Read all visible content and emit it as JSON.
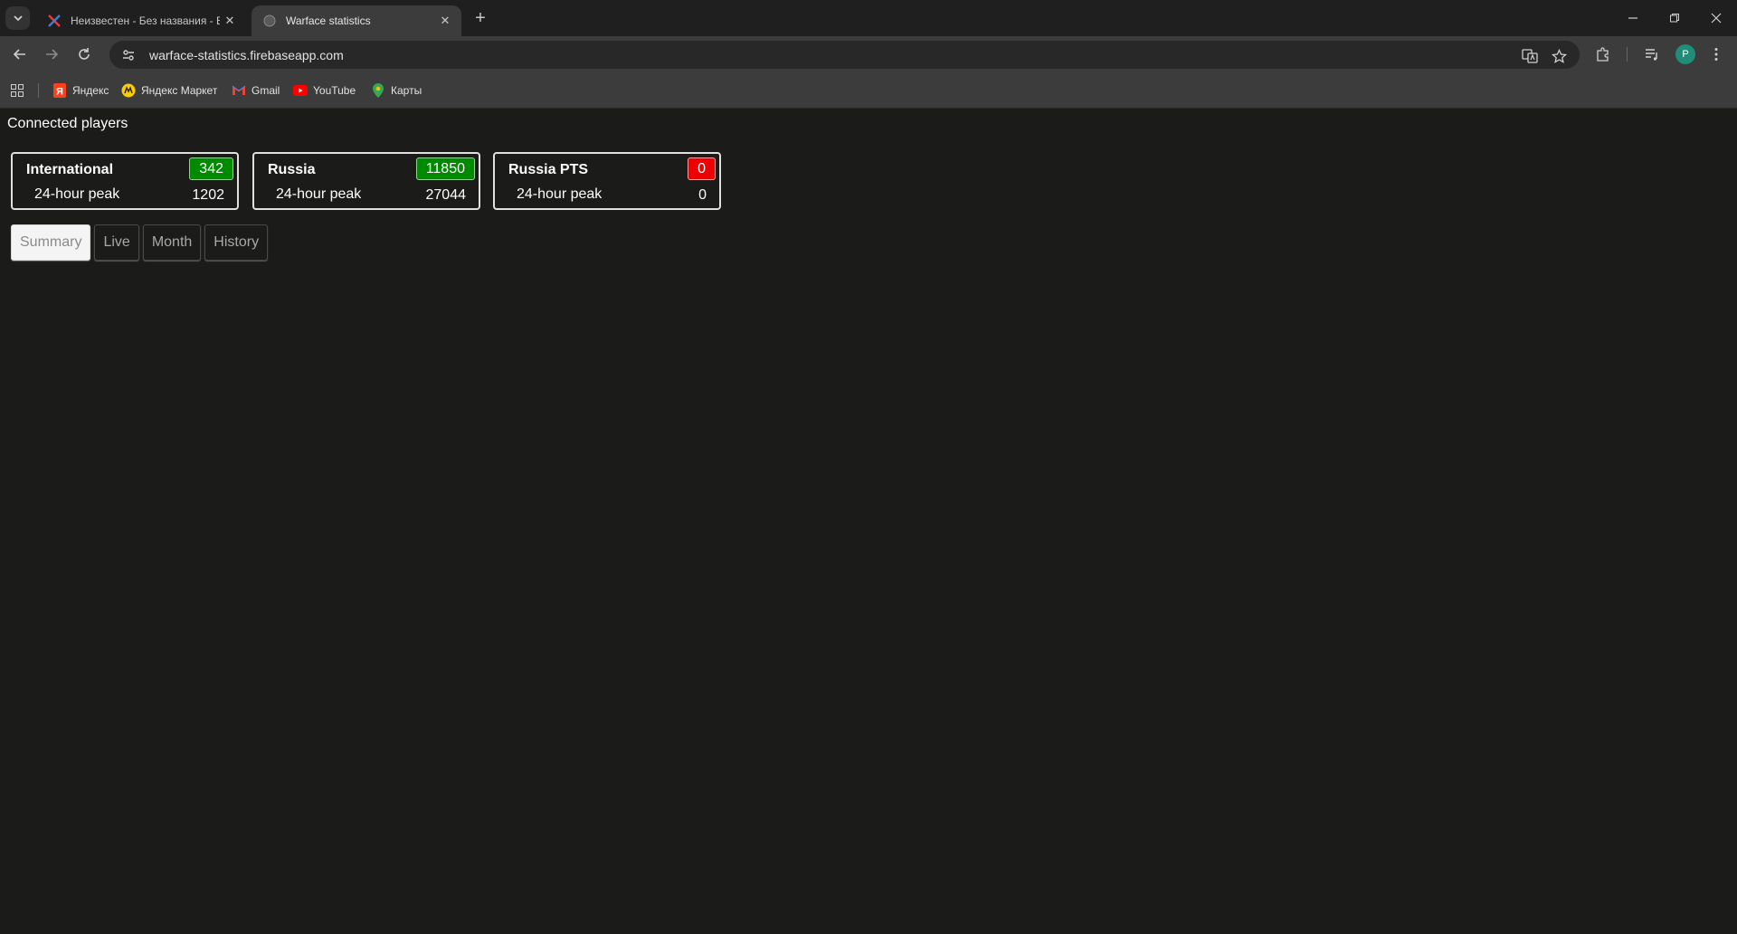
{
  "browser": {
    "tabs": [
      {
        "title": "Неизвестен - Без названия - E",
        "active": false
      },
      {
        "title": "Warface statistics",
        "active": true
      }
    ],
    "url": "warface-statistics.firebaseapp.com",
    "profile_initial": "P",
    "bookmarks": [
      {
        "label": "Яндекс"
      },
      {
        "label": "Яндекс Маркет"
      },
      {
        "label": "Gmail"
      },
      {
        "label": "YouTube"
      },
      {
        "label": "Карты"
      }
    ]
  },
  "page": {
    "title": "Connected players",
    "servers": [
      {
        "name": "International",
        "online": "342",
        "peak_label": "24-hour peak",
        "peak": "1202",
        "status": "green"
      },
      {
        "name": "Russia",
        "online": "11850",
        "peak_label": "24-hour peak",
        "peak": "27044",
        "status": "green"
      },
      {
        "name": "Russia PTS",
        "online": "0",
        "peak_label": "24-hour peak",
        "peak": "0",
        "status": "red"
      }
    ],
    "tabs": [
      {
        "label": "Summary",
        "active": true
      },
      {
        "label": "Live",
        "active": false
      },
      {
        "label": "Month",
        "active": false
      },
      {
        "label": "History",
        "active": false
      }
    ]
  },
  "colors": {
    "online_green": "#008a00",
    "offline_red": "#ee0000",
    "page_bg": "#1b1b1a"
  }
}
